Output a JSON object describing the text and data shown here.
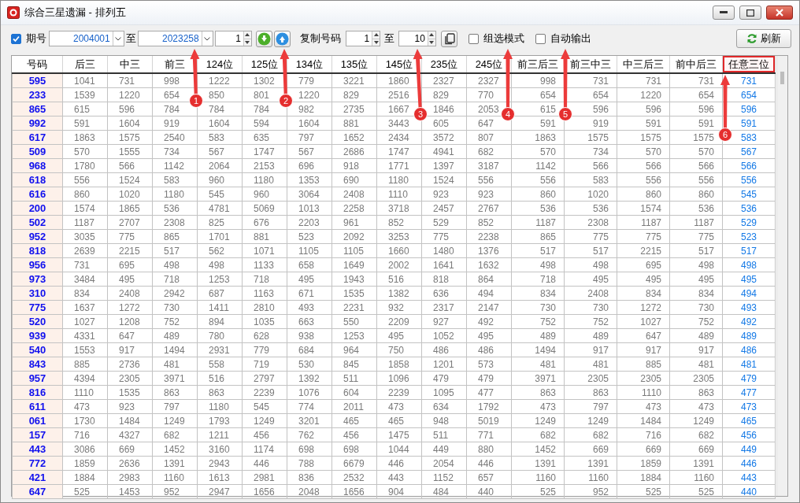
{
  "window": {
    "title": "综合三星遗漏 - 排列五"
  },
  "toolbar": {
    "period": {
      "label": "期号",
      "checked": true
    },
    "from": "2004001",
    "to_label": "至",
    "to": "2023258",
    "step": "1",
    "copy_label": "复制号码",
    "copy_from": "1",
    "copy_to_label": "至",
    "copy_to": "10",
    "options": [
      {
        "label": "组选模式",
        "checked": false
      },
      {
        "label": "自动输出",
        "checked": false
      }
    ],
    "refresh": "刷新"
  },
  "table": {
    "columns": [
      {
        "label": "号码",
        "kind": "key",
        "highlighted": false
      },
      {
        "label": "后三",
        "kind": "count",
        "highlighted": false
      },
      {
        "label": "中三",
        "kind": "count",
        "highlighted": false
      },
      {
        "label": "前三",
        "kind": "count",
        "highlighted": false
      },
      {
        "label": "124位",
        "kind": "count",
        "highlighted": false
      },
      {
        "label": "125位",
        "kind": "count",
        "highlighted": false
      },
      {
        "label": "134位",
        "kind": "count",
        "highlighted": false
      },
      {
        "label": "135位",
        "kind": "count",
        "highlighted": false
      },
      {
        "label": "145位",
        "kind": "count",
        "highlighted": false
      },
      {
        "label": "235位",
        "kind": "count",
        "highlighted": false
      },
      {
        "label": "245位",
        "kind": "count",
        "highlighted": false
      },
      {
        "label": "前三后三",
        "kind": "combo",
        "highlighted": false
      },
      {
        "label": "前三中三",
        "kind": "combo",
        "highlighted": false
      },
      {
        "label": "中三后三",
        "kind": "combo",
        "highlighted": false
      },
      {
        "label": "前中后三",
        "kind": "combo",
        "highlighted": false
      },
      {
        "label": "任意三位",
        "kind": "result",
        "highlighted": true
      }
    ],
    "rows": [
      [
        "595",
        "1041",
        "731",
        "998",
        "1222",
        "1302",
        "779",
        "3221",
        "1860",
        "2327",
        "2327",
        "998",
        "731",
        "731",
        "731",
        "731"
      ],
      [
        "233",
        "1539",
        "1220",
        "654",
        "850",
        "801",
        "1220",
        "829",
        "2516",
        "829",
        "770",
        "654",
        "654",
        "1220",
        "654",
        "654"
      ],
      [
        "865",
        "615",
        "596",
        "784",
        "784",
        "784",
        "982",
        "2735",
        "1667",
        "1846",
        "2053",
        "615",
        "596",
        "596",
        "596",
        "596"
      ],
      [
        "992",
        "591",
        "1604",
        "919",
        "1604",
        "594",
        "1604",
        "881",
        "3443",
        "605",
        "647",
        "591",
        "919",
        "591",
        "591",
        "591"
      ],
      [
        "617",
        "1863",
        "1575",
        "2540",
        "583",
        "635",
        "797",
        "1652",
        "2434",
        "3572",
        "807",
        "1863",
        "1575",
        "1575",
        "1575",
        "583"
      ],
      [
        "509",
        "570",
        "1555",
        "734",
        "567",
        "1747",
        "567",
        "2686",
        "1747",
        "4941",
        "682",
        "570",
        "734",
        "570",
        "570",
        "567"
      ],
      [
        "968",
        "1780",
        "566",
        "1142",
        "2064",
        "2153",
        "696",
        "918",
        "1771",
        "1397",
        "3187",
        "1142",
        "566",
        "566",
        "566",
        "566"
      ],
      [
        "618",
        "556",
        "1524",
        "583",
        "960",
        "1180",
        "1353",
        "690",
        "1180",
        "1524",
        "556",
        "556",
        "583",
        "556",
        "556",
        "556"
      ],
      [
        "616",
        "860",
        "1020",
        "1180",
        "545",
        "960",
        "3064",
        "2408",
        "1110",
        "923",
        "923",
        "860",
        "1020",
        "860",
        "860",
        "545"
      ],
      [
        "200",
        "1574",
        "1865",
        "536",
        "4781",
        "5069",
        "1013",
        "2258",
        "3718",
        "2457",
        "2767",
        "536",
        "536",
        "1574",
        "536",
        "536"
      ],
      [
        "502",
        "1187",
        "2707",
        "2308",
        "825",
        "676",
        "2203",
        "961",
        "852",
        "529",
        "852",
        "1187",
        "2308",
        "1187",
        "1187",
        "529"
      ],
      [
        "952",
        "3035",
        "775",
        "865",
        "1701",
        "881",
        "523",
        "2092",
        "3253",
        "775",
        "2238",
        "865",
        "775",
        "775",
        "775",
        "523"
      ],
      [
        "818",
        "2639",
        "2215",
        "517",
        "562",
        "1071",
        "1105",
        "1105",
        "1660",
        "1480",
        "1376",
        "517",
        "517",
        "2215",
        "517",
        "517"
      ],
      [
        "956",
        "731",
        "695",
        "498",
        "498",
        "1133",
        "658",
        "1649",
        "2002",
        "1641",
        "1632",
        "498",
        "498",
        "695",
        "498",
        "498"
      ],
      [
        "973",
        "3484",
        "495",
        "718",
        "1253",
        "718",
        "495",
        "1943",
        "516",
        "818",
        "864",
        "718",
        "495",
        "495",
        "495",
        "495"
      ],
      [
        "310",
        "834",
        "2408",
        "2942",
        "687",
        "1163",
        "671",
        "1535",
        "1382",
        "636",
        "494",
        "834",
        "2408",
        "834",
        "834",
        "494"
      ],
      [
        "775",
        "1637",
        "1272",
        "730",
        "1411",
        "2810",
        "493",
        "2231",
        "932",
        "2317",
        "2147",
        "730",
        "730",
        "1272",
        "730",
        "493"
      ],
      [
        "520",
        "1027",
        "1208",
        "752",
        "894",
        "1035",
        "663",
        "550",
        "2209",
        "927",
        "492",
        "752",
        "752",
        "1027",
        "752",
        "492"
      ],
      [
        "939",
        "4331",
        "647",
        "489",
        "780",
        "628",
        "938",
        "1253",
        "495",
        "1052",
        "495",
        "489",
        "489",
        "647",
        "489",
        "489"
      ],
      [
        "540",
        "1553",
        "917",
        "1494",
        "2931",
        "779",
        "684",
        "964",
        "750",
        "486",
        "486",
        "1494",
        "917",
        "917",
        "917",
        "486"
      ],
      [
        "843",
        "885",
        "2736",
        "481",
        "558",
        "719",
        "530",
        "845",
        "1858",
        "1201",
        "573",
        "481",
        "481",
        "885",
        "481",
        "481"
      ],
      [
        "957",
        "4394",
        "2305",
        "3971",
        "516",
        "2797",
        "1392",
        "511",
        "1096",
        "479",
        "479",
        "3971",
        "2305",
        "2305",
        "2305",
        "479"
      ],
      [
        "816",
        "1110",
        "1535",
        "863",
        "863",
        "2239",
        "1076",
        "604",
        "2239",
        "1095",
        "477",
        "863",
        "863",
        "1110",
        "863",
        "477"
      ],
      [
        "611",
        "473",
        "923",
        "797",
        "1180",
        "545",
        "774",
        "2011",
        "473",
        "634",
        "1792",
        "473",
        "797",
        "473",
        "473",
        "473"
      ],
      [
        "061",
        "1730",
        "1484",
        "1249",
        "1793",
        "1249",
        "3201",
        "465",
        "465",
        "948",
        "5019",
        "1249",
        "1249",
        "1484",
        "1249",
        "465"
      ],
      [
        "157",
        "716",
        "4327",
        "682",
        "1211",
        "456",
        "762",
        "456",
        "1475",
        "511",
        "771",
        "682",
        "682",
        "716",
        "682",
        "456"
      ],
      [
        "443",
        "3086",
        "669",
        "1452",
        "3160",
        "1174",
        "698",
        "698",
        "1044",
        "449",
        "880",
        "1452",
        "669",
        "669",
        "669",
        "449"
      ],
      [
        "772",
        "1859",
        "2636",
        "1391",
        "2943",
        "446",
        "788",
        "6679",
        "446",
        "2054",
        "446",
        "1391",
        "1391",
        "1859",
        "1391",
        "446"
      ],
      [
        "421",
        "1884",
        "2983",
        "1160",
        "1613",
        "2981",
        "836",
        "2532",
        "443",
        "1152",
        "657",
        "1160",
        "1160",
        "1884",
        "1160",
        "443"
      ],
      [
        "647",
        "525",
        "1453",
        "952",
        "2947",
        "1656",
        "2048",
        "1656",
        "904",
        "484",
        "440",
        "525",
        "952",
        "525",
        "525",
        "440"
      ]
    ]
  },
  "annotations": [
    {
      "number": "1"
    },
    {
      "number": "2"
    },
    {
      "number": "3"
    },
    {
      "number": "4"
    },
    {
      "number": "5"
    },
    {
      "number": "6"
    }
  ]
}
